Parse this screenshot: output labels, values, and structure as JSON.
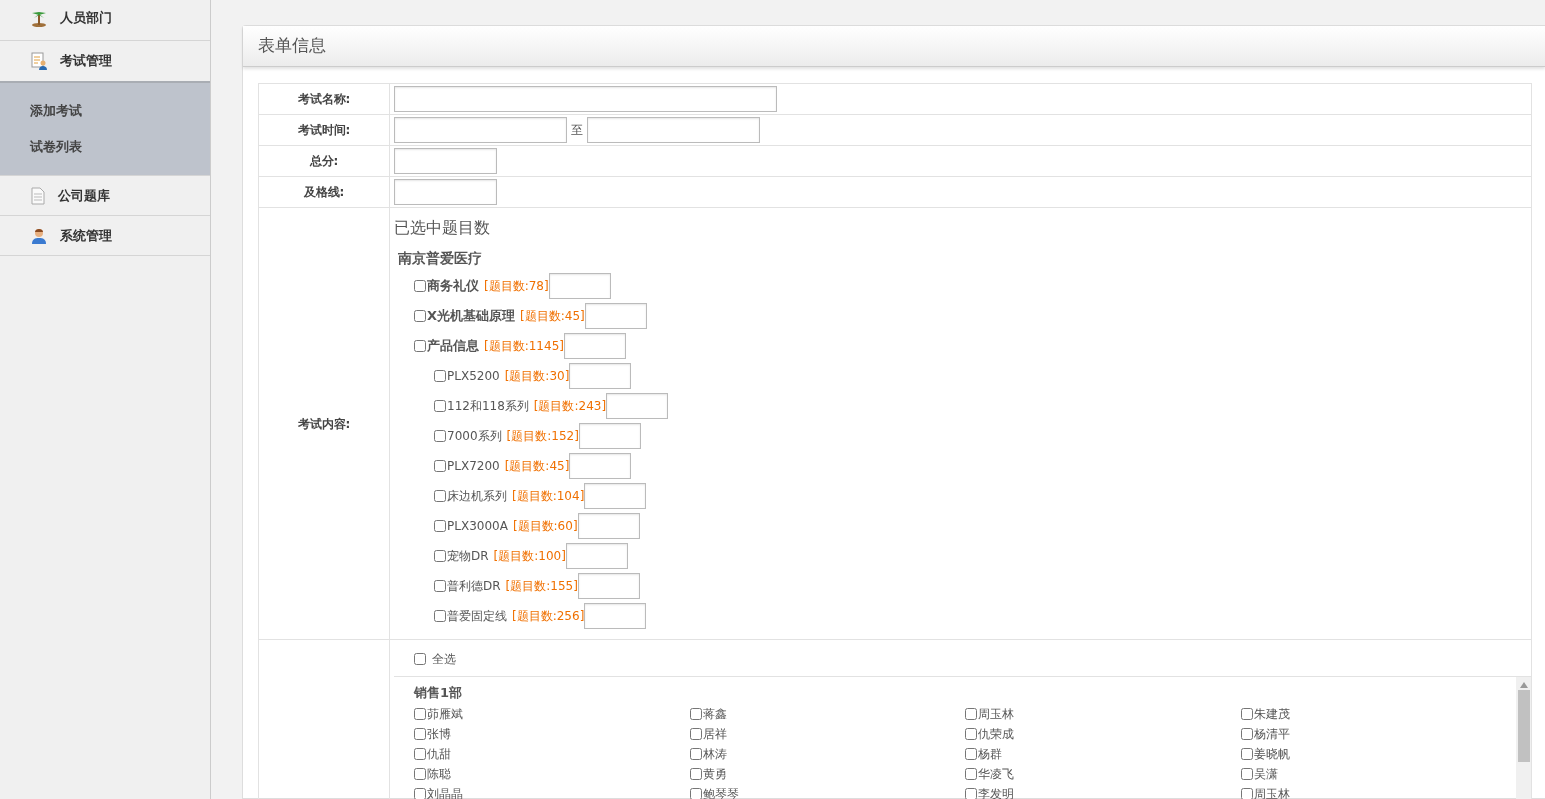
{
  "sidebar": {
    "items": [
      {
        "label": "人员部门",
        "expanded": false
      },
      {
        "label": "考试管理",
        "expanded": true,
        "children": [
          {
            "label": "添加考试"
          },
          {
            "label": "试卷列表"
          }
        ]
      },
      {
        "label": "公司题库",
        "expanded": false
      },
      {
        "label": "系统管理",
        "expanded": false
      }
    ]
  },
  "panel": {
    "title": "表单信息"
  },
  "form": {
    "name_label": "考试名称:",
    "time_label": "考试时间:",
    "time_separator": "至",
    "score_label": "总分:",
    "pass_label": "及格线:",
    "content_label": "考试内容:",
    "selected_heading": "已选中题目数",
    "company": "南京普爱医疗",
    "categories": [
      {
        "label": "商务礼仪",
        "count": "[题目数:78]",
        "checked": false
      },
      {
        "label": "X光机基础原理",
        "count": "[题目数:45]",
        "checked": false
      },
      {
        "label": "产品信息",
        "count": "[题目数:1145]",
        "checked": false,
        "children": [
          {
            "label": "PLX5200",
            "count": "[题目数:30]",
            "checked": false
          },
          {
            "label": "112和118系列",
            "count": "[题目数:243]",
            "checked": false
          },
          {
            "label": "7000系列",
            "count": "[题目数:152]",
            "checked": false
          },
          {
            "label": "PLX7200",
            "count": "[题目数:45]",
            "checked": false
          },
          {
            "label": "床边机系列",
            "count": "[题目数:104]",
            "checked": false
          },
          {
            "label": "PLX3000A",
            "count": "[题目数:60]",
            "checked": false
          },
          {
            "label": "宠物DR",
            "count": "[题目数:100]",
            "checked": false
          },
          {
            "label": "普利德DR",
            "count": "[题目数:155]",
            "checked": false
          },
          {
            "label": "普爱固定线",
            "count": "[题目数:256]",
            "checked": false
          }
        ]
      }
    ],
    "select_all": {
      "label": "全选",
      "checked": false
    },
    "departments": [
      {
        "name": "销售1部",
        "people": [
          {
            "name": "茆雁斌",
            "checked": false
          },
          {
            "name": "蒋鑫",
            "checked": false
          },
          {
            "name": "周玉林",
            "checked": false
          },
          {
            "name": "朱建茂",
            "checked": false
          },
          {
            "name": "张博",
            "checked": false
          },
          {
            "name": "居祥",
            "checked": false
          },
          {
            "name": "仇荣成",
            "checked": false
          },
          {
            "name": "杨清平",
            "checked": false
          },
          {
            "name": "仇甜",
            "checked": false
          },
          {
            "name": "林涛",
            "checked": false
          },
          {
            "name": "杨群",
            "checked": false
          },
          {
            "name": "姜晓帆",
            "checked": false
          },
          {
            "name": "陈聪",
            "checked": false
          },
          {
            "name": "黄勇",
            "checked": false
          },
          {
            "name": "华凌飞",
            "checked": false
          },
          {
            "name": "吴潇",
            "checked": false
          },
          {
            "name": "刘晶晶",
            "checked": false
          },
          {
            "name": "鲍琴琴",
            "checked": false
          },
          {
            "name": "李发明",
            "checked": false
          },
          {
            "name": "周玉林",
            "checked": false
          }
        ]
      }
    ]
  }
}
